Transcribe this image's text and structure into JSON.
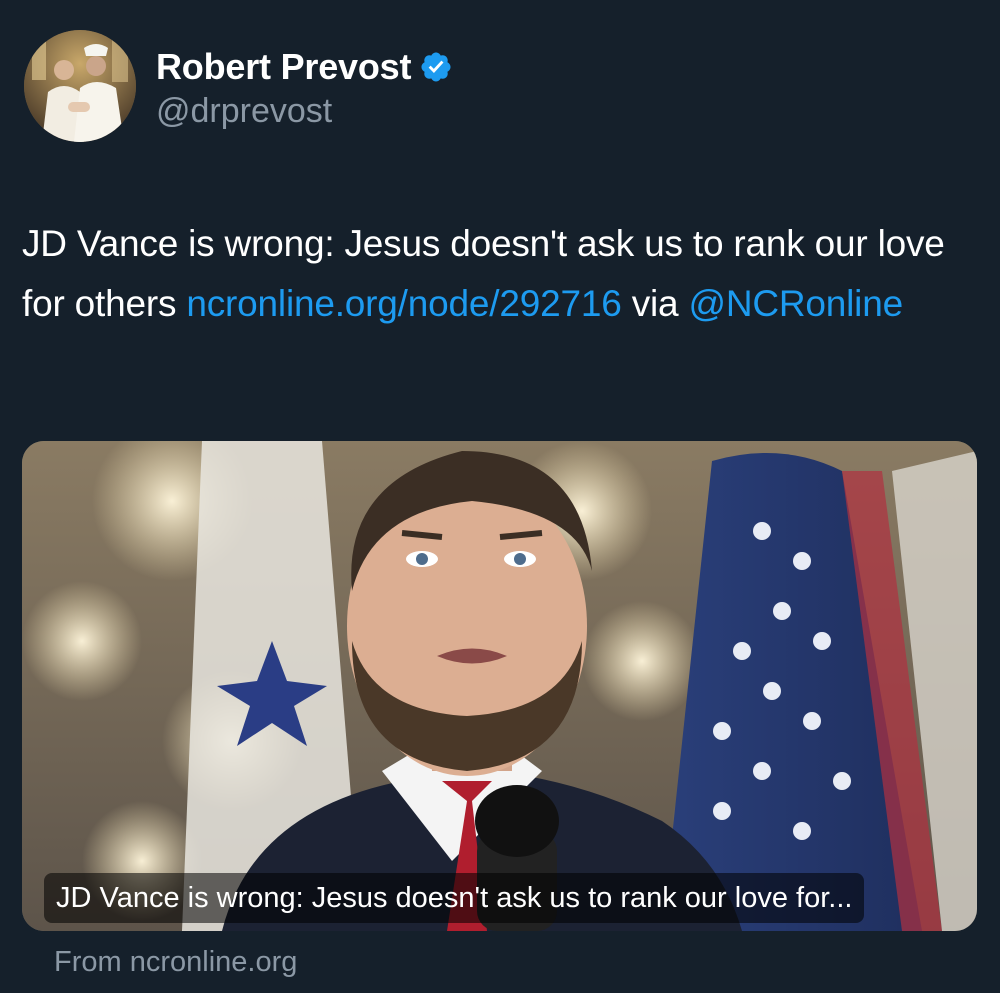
{
  "author": {
    "display_name": "Robert Prevost",
    "handle": "@drprevost",
    "verified": true,
    "avatar_icon": "avatar-photo"
  },
  "tweet": {
    "text_before_link": "JD Vance is wrong: Jesus doesn't ask us to rank our love for others ",
    "link_text": "ncronline.org/node/292716",
    "text_via": " via ",
    "mention": "@NCRonline"
  },
  "card": {
    "title": "JD Vance is wrong: Jesus doesn't ask us to rank our love for...",
    "source": "From ncronline.org"
  },
  "colors": {
    "background": "#15202b",
    "link": "#1d9bf0",
    "secondary_text": "#8b98a5",
    "verified_badge": "#1d9bf0"
  }
}
